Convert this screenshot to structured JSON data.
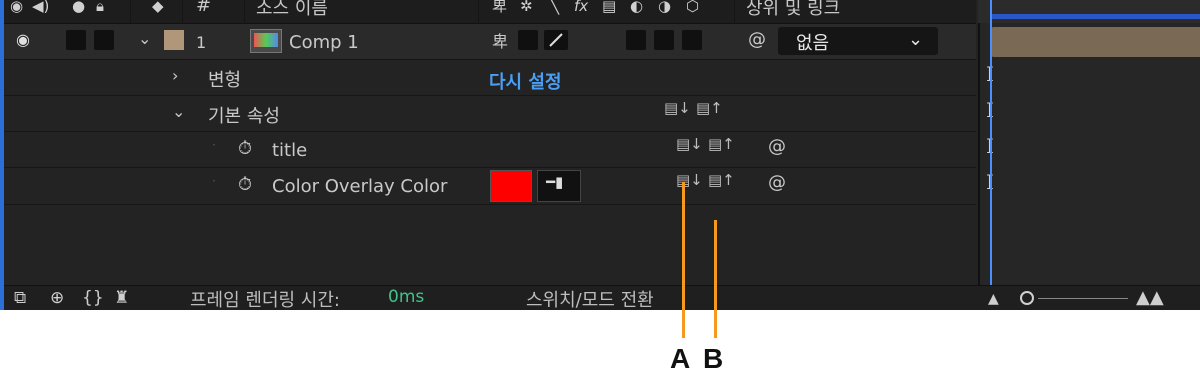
{
  "header": {
    "col_source": "소스 이름",
    "col_parent": "상위 및 링크",
    "col_hash": "#"
  },
  "layer": {
    "number": "1",
    "name": "Comp 1",
    "parent_value": "없음"
  },
  "rows": {
    "transform": "변형",
    "reset": "다시 설정",
    "essential": "기본 속성",
    "title": "title",
    "color_overlay": "Color Overlay Color"
  },
  "colors": {
    "swatch": "#ff0000",
    "accent_link": "#4a9ff5",
    "annotation": "#f39a1f",
    "label_color": "#b0977a"
  },
  "bottom": {
    "render_label": "프레임 렌더링 시간:",
    "render_value": "0ms",
    "toggle_label": "스위치/모드 전환"
  },
  "annotations": {
    "a": "A",
    "b": "B"
  }
}
